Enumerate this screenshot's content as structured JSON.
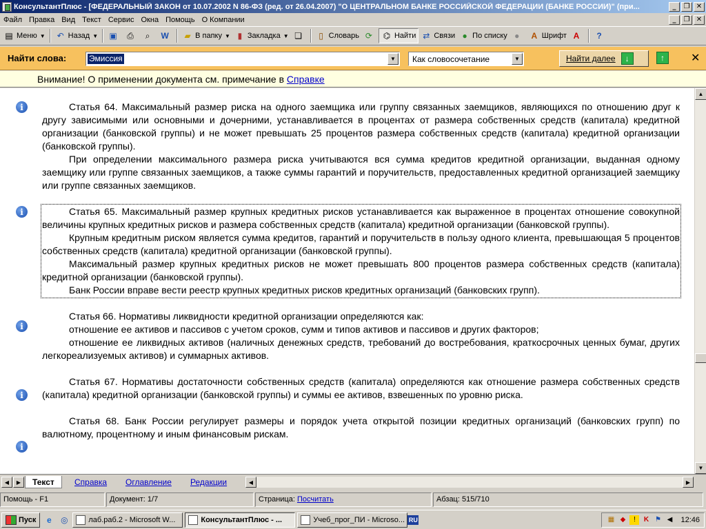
{
  "window": {
    "title": "КонсультантПлюс - [ФЕДЕРАЛЬНЫЙ ЗАКОН от 10.07.2002 N 86-ФЗ (ред. от 26.04.2007) \"О ЦЕНТРАЛЬНОМ БАНКЕ РОССИЙСКОЙ ФЕДЕРАЦИИ (БАНКЕ РОССИИ)\" (при..."
  },
  "menu": [
    "Файл",
    "Правка",
    "Вид",
    "Текст",
    "Сервис",
    "Окна",
    "Помощь",
    "О Компании"
  ],
  "toolbar": {
    "menu": "Меню",
    "back": "Назад",
    "to_folder": "В папку",
    "bookmark": "Закладка",
    "dictionary": "Словарь",
    "find": "Найти",
    "links": "Связи",
    "by_list": "По списку",
    "font": "Шрифт"
  },
  "search": {
    "label": "Найти слова:",
    "value": "Эмиссия",
    "mode": "Как словосочетание",
    "find_next": "Найти далее"
  },
  "warning": {
    "text": "Внимание! О применении документа см. примечание в ",
    "link": "Справке"
  },
  "articles": [
    {
      "paragraphs": [
        "Статья 64. Максимальный размер риска на одного заемщика или группу связанных заемщиков, являющихся по отношению друг к другу зависимыми или основными и дочерними, устанавливается в процентах от размера собственных средств (капитала) кредитной организации (банковской группы) и не может превышать 25 процентов размера собственных средств (капитала) кредитной организации (банковской группы).",
        "При определении максимального размера риска учитываются вся сумма кредитов кредитной организации, выданная одному заемщику или группе связанных заемщиков, а также суммы гарантий и поручительств, предоставленных кредитной организацией заемщику или группе связанных заемщиков."
      ]
    },
    {
      "paragraphs": [
        "Статья 65. Максимальный размер крупных кредитных рисков устанавливается как выраженное в процентах отношение совокупной величины крупных кредитных рисков и размера собственных средств (капитала) кредитной организации (банковской группы).",
        "Крупным кредитным риском является сумма кредитов, гарантий и поручительств в пользу одного клиента, превышающая 5 процентов собственных средств (капитала) кредитной организации (банковской группы).",
        "Максимальный размер крупных кредитных рисков не может превышать 800 процентов размера собственных средств (капитала) кредитной организации (банковской группы).",
        "Банк России вправе вести реестр крупных кредитных рисков кредитных организаций (банковских групп)."
      ]
    },
    {
      "paragraphs": [
        "Статья 66. Нормативы ликвидности кредитной организации определяются как:",
        "отношение ее активов и пассивов с учетом сроков, сумм и типов активов и пассивов и других факторов;",
        "отношение ее ликвидных активов (наличных денежных средств, требований до востребования, краткосрочных ценных бумаг, других легкореализуемых активов) и суммарных активов."
      ]
    },
    {
      "paragraphs": [
        "Статья 67. Нормативы достаточности собственных средств (капитала) определяются как отношение размера собственных средств (капитала) кредитной организации (банковской группы) и суммы ее активов, взвешенных по уровню риска."
      ]
    },
    {
      "paragraphs": [
        "Статья 68. Банк России регулирует размеры и порядок учета открытой позиции кредитных организаций (банковских групп) по валютному, процентному и иным финансовым рискам."
      ]
    }
  ],
  "tabs": [
    "Текст",
    "Справка",
    "Оглавление",
    "Редакции"
  ],
  "status": {
    "help": "Помощь - F1",
    "document": "Документ: 1/7",
    "page_label": "Страница: ",
    "page_link": "Посчитать",
    "paragraph": "Абзац: 515/710"
  },
  "taskbar": {
    "start": "Пуск",
    "tasks": [
      "лаб.раб.2 - Microsoft W...",
      "КонсультантПлюс - ...",
      "Учеб_прог_ПИ - Microso..."
    ],
    "lang": "RU",
    "clock": "12:46"
  }
}
